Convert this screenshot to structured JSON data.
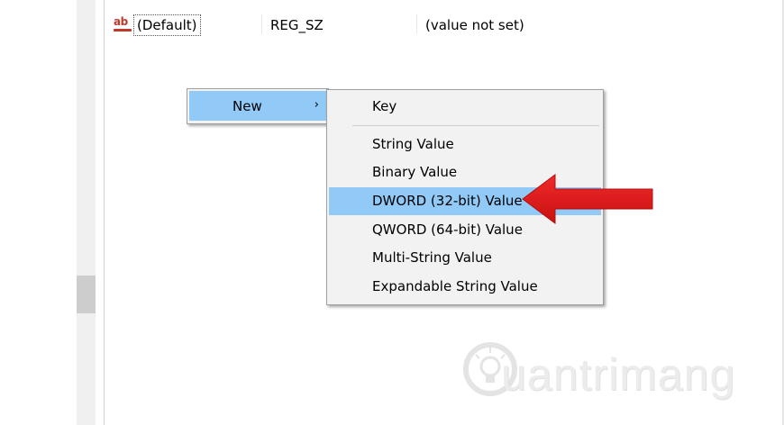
{
  "registry_row": {
    "name": "(Default)",
    "type": "REG_SZ",
    "data": "(value not set)",
    "icon": "ab-string-value-icon"
  },
  "context_menu": {
    "new_label": "New",
    "new_arrow": "›"
  },
  "submenu": {
    "items": [
      {
        "label": "Key"
      },
      {
        "label": "String Value"
      },
      {
        "label": "Binary Value"
      },
      {
        "label": "DWORD (32-bit) Value"
      },
      {
        "label": "QWORD (64-bit) Value"
      },
      {
        "label": "Multi-String Value"
      },
      {
        "label": "Expandable String Value"
      }
    ],
    "highlighted_item": "DWORD (32-bit) Value"
  },
  "annotation": {
    "arrow_color": "#e41b1b",
    "icon": "red-arrow-icon"
  },
  "watermark": {
    "text": "uantrimang",
    "icon": "lightbulb-icon"
  },
  "colors": {
    "highlight": "#91c9f7",
    "menu_bg": "#f2f2f2",
    "string_icon": "#c0392b"
  }
}
